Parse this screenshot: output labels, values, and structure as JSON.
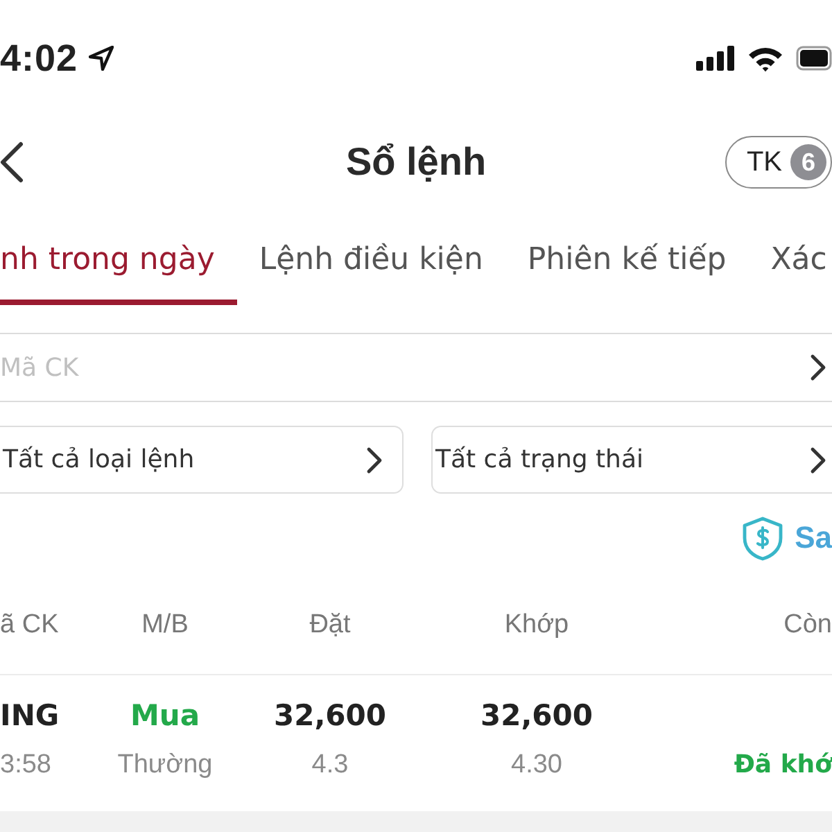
{
  "status_bar": {
    "time": "4:02"
  },
  "nav": {
    "title": "Sổ lệnh",
    "account_button": {
      "label": "TK",
      "badge": "6"
    }
  },
  "tabs": [
    {
      "label": "nh trong ngày",
      "selected": true
    },
    {
      "label": "Lệnh điều kiện",
      "selected": false
    },
    {
      "label": "Phiên kế tiếp",
      "selected": false
    },
    {
      "label": "Xác",
      "selected": false
    }
  ],
  "search": {
    "placeholder": "Mã CK"
  },
  "filters": [
    {
      "label": "Tất cả loại lệnh"
    },
    {
      "label": "Tất cả trạng thái"
    }
  ],
  "link": {
    "label": "Sa"
  },
  "table": {
    "columns": [
      "ã CK",
      "M/B",
      "Đặt",
      "Khớp",
      "Còn"
    ],
    "rows": [
      {
        "symbol": "ING",
        "time": "3:58",
        "side": {
          "text": "Mua",
          "color": "#23a94a"
        },
        "order_type": "Thường",
        "order_price": "32,600",
        "order_qty": "4.3",
        "match_price": "32,600",
        "match_qty": "4.30",
        "status": {
          "text": "Đã khớ",
          "color": "#23a94a"
        }
      }
    ]
  }
}
